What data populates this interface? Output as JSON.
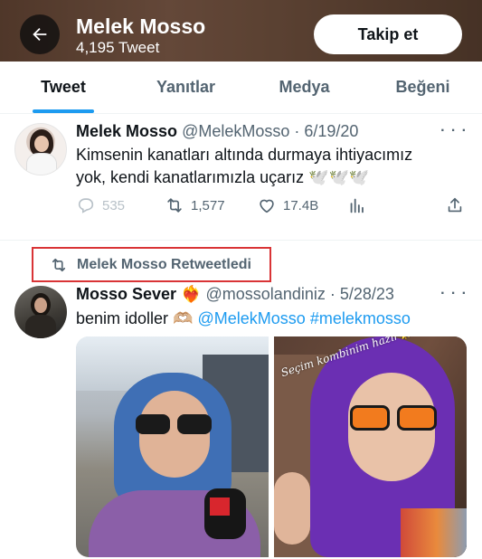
{
  "header": {
    "name": "Melek Mosso",
    "tweet_count": "4,195 Tweet",
    "follow_label": "Takip et"
  },
  "tabs": [
    {
      "label": "Tweet",
      "active": true
    },
    {
      "label": "Yanıtlar",
      "active": false
    },
    {
      "label": "Medya",
      "active": false
    },
    {
      "label": "Beğeni",
      "active": false
    }
  ],
  "tweets": [
    {
      "name": "Melek Mosso",
      "handle": "@MelekMosso",
      "date": "6/19/20",
      "text_line1": "Kimsenin kanatları altında durmaya ihtiyacımız",
      "text_line2": "yok, kendi kanatlarımızla uçarız 🕊️🕊️🕊️",
      "replies": "535",
      "retweets": "1,577",
      "likes": "17.4B"
    },
    {
      "retweeted_by": "Melek Mosso Retweetledi",
      "name": "Mosso Sever",
      "name_emoji": "❤️‍🔥",
      "handle": "@mossolandiniz",
      "date": "5/28/23",
      "text": "benim idoller 🫶🏼",
      "mention": "@MelekMosso",
      "hashtag": "#melekmosso",
      "photo_caption": "Seçim kombinim hazır🌟"
    }
  ],
  "colors": {
    "accent": "#1d9bf0",
    "text_primary": "#0f1419",
    "text_secondary": "#536471",
    "highlight_box": "#d93436"
  },
  "icons": {
    "back": "arrow-left-icon",
    "reply": "reply-icon",
    "retweet": "retweet-icon",
    "like": "heart-icon",
    "views": "analytics-icon",
    "share": "share-icon",
    "more": "more-icon"
  }
}
